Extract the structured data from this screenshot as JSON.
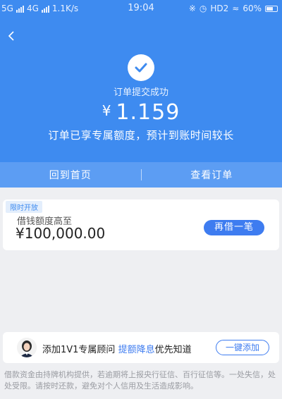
{
  "status_bar": {
    "left_text": "5G",
    "network": "4G",
    "speed": "1.1K/s",
    "time": "19:04",
    "hd_label": "HD2",
    "battery": "60%"
  },
  "header": {
    "back_icon": "chevron-left-icon",
    "success_icon": "check-icon",
    "success_text": "订单提交成功",
    "currency": "¥",
    "amount": "1.159",
    "notice": "订单已享专属额度，预计到账时间较长"
  },
  "actions": {
    "home_label": "回到首页",
    "view_order_label": "查看订单"
  },
  "credit_card": {
    "badge": "限时开放",
    "label": "借钱额度高至",
    "amount": "¥100,000.00",
    "borrow_button": "再借一笔"
  },
  "advisor": {
    "text_prefix": "添加1V1专属顾问",
    "text_highlight": "提额降息",
    "text_suffix": "优先知道",
    "add_button": "一键添加"
  },
  "disclaimer": "借款资金由持牌机构提供，若逾期将上报央行征信、百行征信等。一处失信，处处受限。请按时还款，避免对个人信用及生活造成影响。",
  "colors": {
    "primary": "#3e8bf0",
    "button_blue": "#3e7cf0",
    "background": "#eeeff2"
  }
}
